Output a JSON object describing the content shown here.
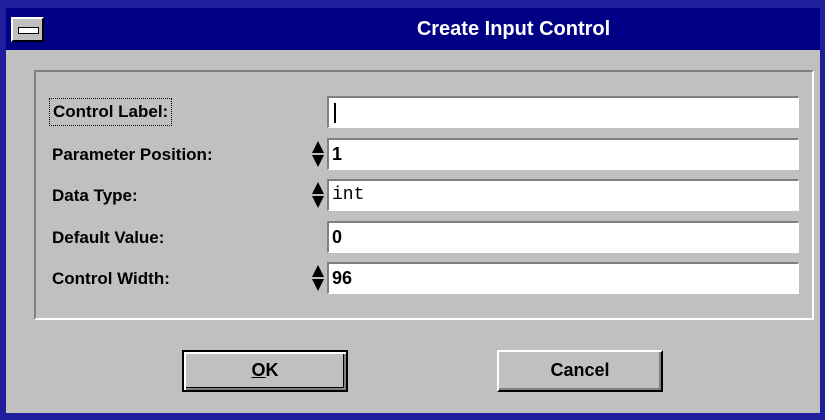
{
  "window": {
    "title": "Create Input Control"
  },
  "form": {
    "control_label": {
      "label": "Control Label:",
      "value": ""
    },
    "parameter_position": {
      "label": "Parameter Position:",
      "value": "1"
    },
    "data_type": {
      "label": "Data Type:",
      "value": "int"
    },
    "default_value": {
      "label": "Default Value:",
      "value": "0"
    },
    "control_width": {
      "label": "Control Width:",
      "value": "96"
    }
  },
  "buttons": {
    "ok_mnemonic": "O",
    "ok_rest": "K",
    "cancel": "Cancel"
  },
  "colors": {
    "titlebar": "#000084",
    "frame": "#1f1f9c",
    "face": "#c0c0c0"
  }
}
